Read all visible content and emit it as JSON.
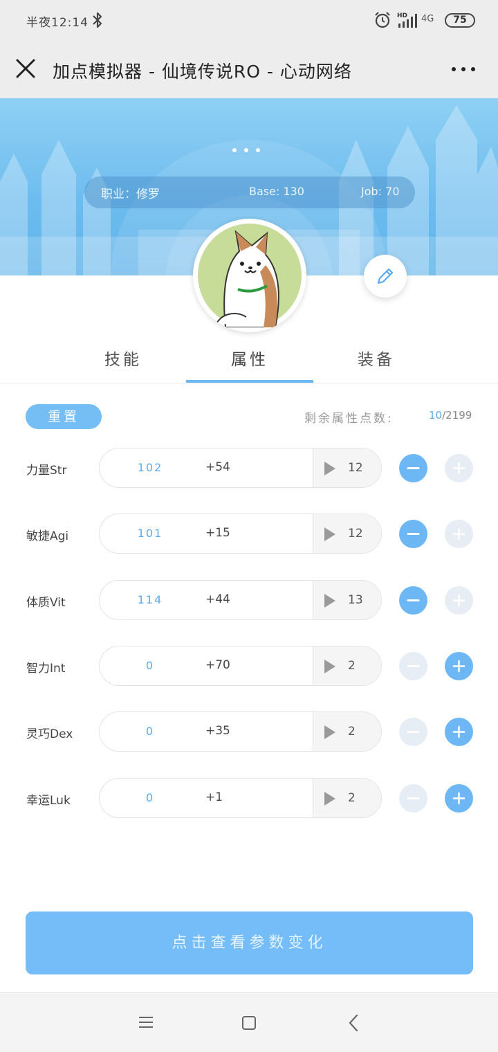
{
  "status_bar": {
    "time": "半夜12:14",
    "network": "4G",
    "battery": "75"
  },
  "header": {
    "title": "加点模拟器 - 仙境传说RO - 心动网络"
  },
  "profile": {
    "job_label": "职业：修罗",
    "base_level": "Base: 130",
    "job_level": "Job: 70"
  },
  "tabs": [
    {
      "label": "技能"
    },
    {
      "label": "属性"
    },
    {
      "label": "装备"
    }
  ],
  "active_tab": "属性",
  "controls": {
    "reset_label": "重置",
    "remaining_label": "剩余属性点数:",
    "remaining_used": "10",
    "remaining_total": "/2199"
  },
  "attributes": [
    {
      "name": "力量Str",
      "value": "102",
      "bonus": "+54",
      "cost": "12"
    },
    {
      "name": "敏捷Agi",
      "value": "101",
      "bonus": "+15",
      "cost": "12"
    },
    {
      "name": "体质Vit",
      "value": "114",
      "bonus": "+44",
      "cost": "13"
    },
    {
      "name": "智力Int",
      "value": "0",
      "bonus": "+70",
      "cost": "2"
    },
    {
      "name": "灵巧Dex",
      "value": "0",
      "bonus": "+35",
      "cost": "2"
    },
    {
      "name": "幸运Luk",
      "value": "0",
      "bonus": "+1",
      "cost": "2"
    }
  ],
  "footer": {
    "view_changes_label": "点击查看参数变化"
  },
  "colors": {
    "accent": "#74bdf5",
    "banner": "#6fbdef"
  }
}
